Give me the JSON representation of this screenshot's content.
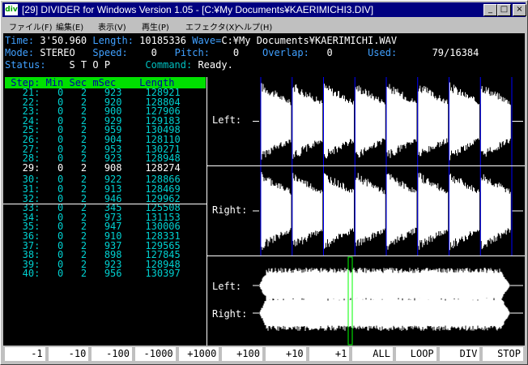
{
  "window": {
    "title": "[29] DIVIDER for Windows Version 1.05 - [C:¥My Documents¥KAERIMICHI3.DIV]",
    "app_icon": "div"
  },
  "menu": [
    "ファイル(F)",
    "編集(E)",
    "表示(V)",
    "再生(P)",
    "エフェクタ(X)",
    "ヘルプ(H)"
  ],
  "info": {
    "time_label": "Time:",
    "time_value": "3'50.960",
    "length_label": "Length:",
    "length_value": "10185336",
    "wave_label": "Wave=",
    "wave_value": "C:¥My Documents¥KAERIMICHI.WAV",
    "mode_label": "Mode:",
    "mode_value": "STEREO",
    "speed_label": "Speed:",
    "speed_value": "0",
    "pitch_label": "Pitch:",
    "pitch_value": "0",
    "overlap_label": "Overlap:",
    "overlap_value": "0",
    "used_label": "Used:",
    "used_value": "79/16384",
    "status_label": "Status:",
    "status_value": "S T O P",
    "command_label": "Command:",
    "command_value": "Ready."
  },
  "table": {
    "header": " Step: Min Sec mSec    Length",
    "current_step": "29",
    "rows": [
      [
        "21",
        "0",
        "2",
        "923",
        "128921"
      ],
      [
        "22",
        "0",
        "2",
        "920",
        "128804"
      ],
      [
        "23",
        "0",
        "2",
        "900",
        "127906"
      ],
      [
        "24",
        "0",
        "2",
        "929",
        "129183"
      ],
      [
        "25",
        "0",
        "2",
        "959",
        "130498"
      ],
      [
        "26",
        "0",
        "2",
        "904",
        "128110"
      ],
      [
        "27",
        "0",
        "2",
        "953",
        "130271"
      ],
      [
        "28",
        "0",
        "2",
        "923",
        "128948"
      ],
      [
        "29",
        "0",
        "2",
        "908",
        "128274"
      ],
      [
        "30",
        "0",
        "2",
        "922",
        "128866"
      ],
      [
        "31",
        "0",
        "2",
        "913",
        "128469"
      ],
      [
        "32",
        "0",
        "2",
        "946",
        "129962"
      ],
      [
        "33",
        "0",
        "2",
        "345",
        "125508"
      ],
      [
        "34",
        "0",
        "2",
        "973",
        "131153"
      ],
      [
        "35",
        "0",
        "2",
        "947",
        "130006"
      ],
      [
        "36",
        "0",
        "2",
        "910",
        "128331"
      ],
      [
        "37",
        "0",
        "2",
        "937",
        "129565"
      ],
      [
        "38",
        "0",
        "2",
        "898",
        "127845"
      ],
      [
        "39",
        "0",
        "2",
        "923",
        "128948"
      ],
      [
        "40",
        "0",
        "2",
        "956",
        "130397"
      ]
    ]
  },
  "waveform": {
    "left_label": "Left:",
    "right_label": "Right:",
    "overview_left_label": "Left:",
    "overview_right_label": "Right:",
    "marker_color": "#0000ff",
    "cursor_color": "#00ff00"
  },
  "buttons": [
    "-1",
    "-10",
    "-100",
    "-1000",
    "+1000",
    "+100",
    "+10",
    "+1",
    "ALL",
    "LOOP",
    "DIV",
    "STOP"
  ],
  "colors": {
    "title_bar": "#000080",
    "info_label": "#40a0ff",
    "table_text": "#00d0d0",
    "header_bg": "#00e000"
  }
}
